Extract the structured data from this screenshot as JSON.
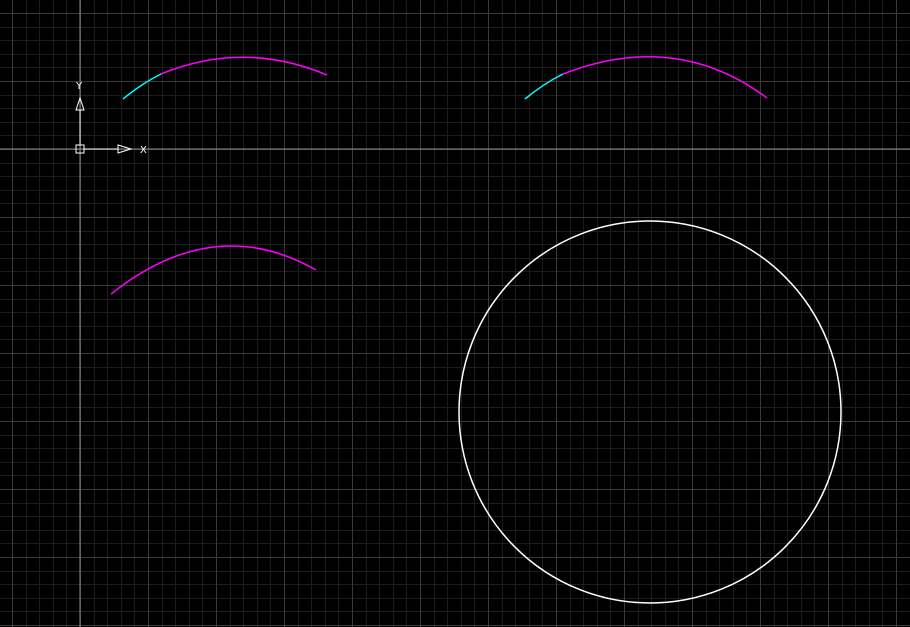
{
  "canvas": {
    "background": "#000000",
    "grid_minor_color": "#1c1c1c",
    "grid_major_color": "#3a3a3a",
    "axis_line_color": "#8a8a8a"
  },
  "ucs": {
    "x_label": "X",
    "y_label": "Y",
    "color": "#ffffff"
  },
  "entities": {
    "arc_color_primary": "#ff00ff",
    "arc_color_highlight": "#00ffff",
    "circle_color": "#ffffff"
  }
}
